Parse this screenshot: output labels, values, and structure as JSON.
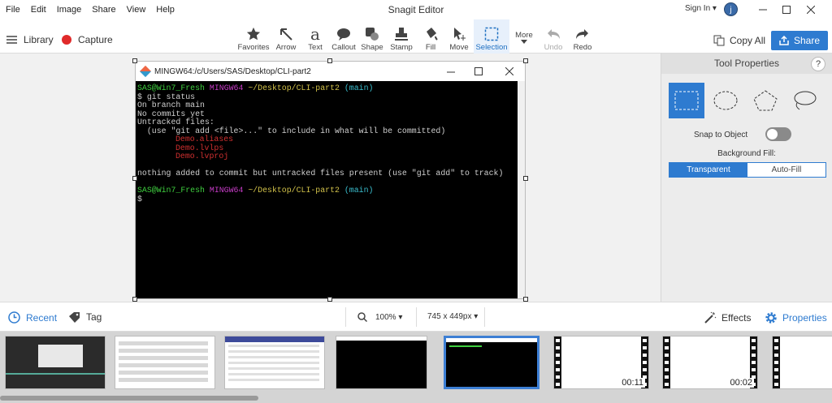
{
  "menu": [
    "File",
    "Edit",
    "Image",
    "Share",
    "View",
    "Help"
  ],
  "app_title": "Snagit Editor",
  "account": {
    "sign_in": "Sign In ▾",
    "avatar_letter": "j"
  },
  "toolbar": {
    "library": "Library",
    "capture": "Capture",
    "tools": [
      "Favorites",
      "Arrow",
      "Text",
      "Callout",
      "Shape",
      "Stamp",
      "Fill",
      "Move",
      "Selection",
      "More",
      "Undo",
      "Redo"
    ],
    "text_glyph": "a",
    "copy_all": "Copy All",
    "share": "Share",
    "active_tool": "Selection"
  },
  "terminal": {
    "title": "MINGW64:/c/Users/SAS/Desktop/CLI-part2",
    "prompt_user": "SAS@Win7_Fresh",
    "prompt_env": "MINGW64",
    "prompt_path": "~/Desktop/CLI-part2",
    "prompt_branch": "(main)",
    "lines": [
      "$ git status",
      "On branch main",
      "",
      "No commits yet",
      "",
      "Untracked files:",
      "  (use \"git add <file>...\" to include in what will be committed)"
    ],
    "untracked": [
      "Demo.aliases",
      "Demo.lvlps",
      "Demo.lvproj"
    ],
    "footer_line": "nothing added to commit but untracked files present (use \"git add\" to track)",
    "final_prompt": "$"
  },
  "panel": {
    "title": "Tool Properties",
    "help": "?",
    "snap_label": "Snap to Object",
    "snap_on": false,
    "fill_label": "Background Fill:",
    "fill_options": [
      "Transparent",
      "Auto-Fill"
    ],
    "fill_selected": "Transparent"
  },
  "status": {
    "recent": "Recent",
    "tag": "Tag",
    "zoom": "100% ▾",
    "dimensions": "745 x 449px ▾",
    "effects": "Effects",
    "properties": "Properties"
  },
  "tray": {
    "durations": [
      "00:11",
      "00:02"
    ]
  },
  "colors": {
    "accent": "#2e7bd0",
    "record": "#e02a2a",
    "terminal_bg": "#000000"
  }
}
